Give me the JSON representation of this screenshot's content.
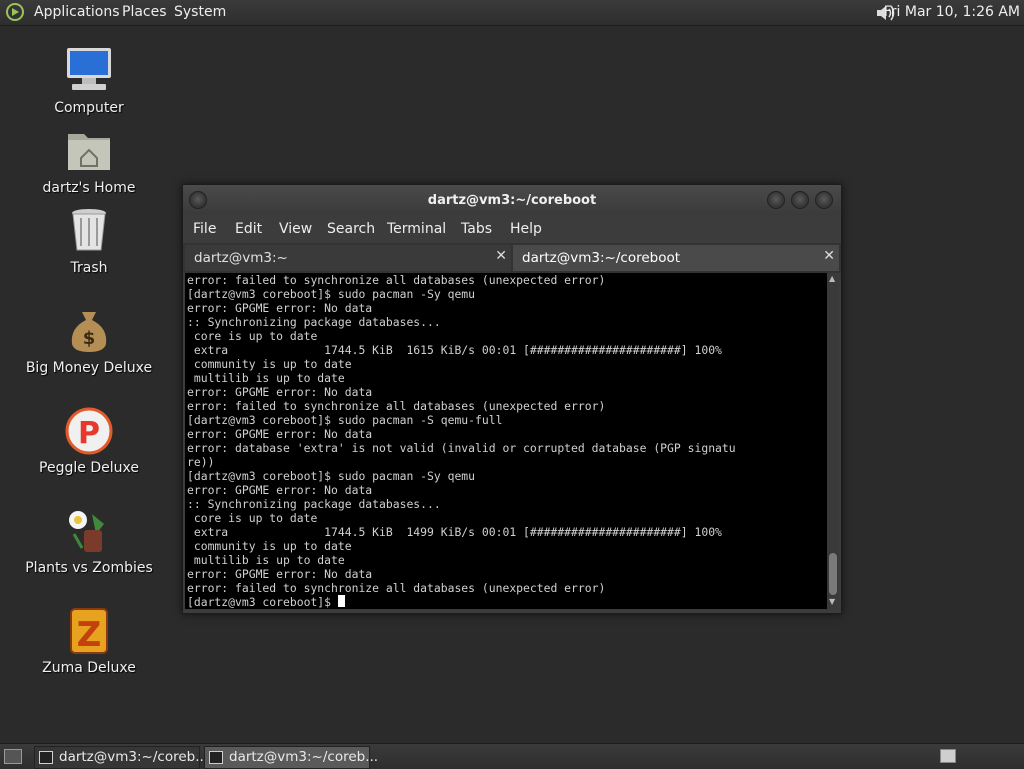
{
  "top_panel": {
    "menus": [
      "Applications",
      "Places",
      "System"
    ],
    "clock": "Fri Mar 10,  1:26 AM"
  },
  "desktop": {
    "icons": [
      {
        "label": "Computer",
        "icon": "computer-icon"
      },
      {
        "label": "dartz's Home",
        "icon": "home-folder-icon"
      },
      {
        "label": "Trash",
        "icon": "trash-icon"
      },
      {
        "label": "Big Money Deluxe",
        "icon": "money-bag-icon"
      },
      {
        "label": "Peggle Deluxe",
        "icon": "peggle-icon"
      },
      {
        "label": "Plants vs Zombies",
        "icon": "plants-vs-zombies-icon"
      },
      {
        "label": "Zuma Deluxe",
        "icon": "zuma-icon"
      }
    ]
  },
  "window": {
    "title": "dartz@vm3:~/coreboot",
    "menu": [
      "File",
      "Edit",
      "View",
      "Search",
      "Terminal",
      "Tabs",
      "Help"
    ],
    "tabs": [
      {
        "label": "dartz@vm3:~",
        "active": false
      },
      {
        "label": "dartz@vm3:~/coreboot",
        "active": true
      }
    ],
    "terminal_lines": [
      "error: failed to synchronize all databases (unexpected error)",
      "[dartz@vm3 coreboot]$ sudo pacman -Sy qemu",
      "error: GPGME error: No data",
      ":: Synchronizing package databases...",
      " core is up to date",
      " extra              1744.5 KiB  1615 KiB/s 00:01 [######################] 100%",
      " community is up to date",
      " multilib is up to date",
      "error: GPGME error: No data",
      "error: failed to synchronize all databases (unexpected error)",
      "[dartz@vm3 coreboot]$ sudo pacman -S qemu-full",
      "error: GPGME error: No data",
      "error: database 'extra' is not valid (invalid or corrupted database (PGP signatu",
      "re))",
      "[dartz@vm3 coreboot]$ sudo pacman -Sy qemu",
      "error: GPGME error: No data",
      ":: Synchronizing package databases...",
      " core is up to date",
      " extra              1744.5 KiB  1499 KiB/s 00:01 [######################] 100%",
      " community is up to date",
      " multilib is up to date",
      "error: GPGME error: No data",
      "error: failed to synchronize all databases (unexpected error)"
    ],
    "prompt": "[dartz@vm3 coreboot]$ "
  },
  "bottom_panel": {
    "tasks": [
      {
        "label": "dartz@vm3:~/coreb...",
        "active": false
      },
      {
        "label": "dartz@vm3:~/coreb...",
        "active": true
      }
    ]
  }
}
